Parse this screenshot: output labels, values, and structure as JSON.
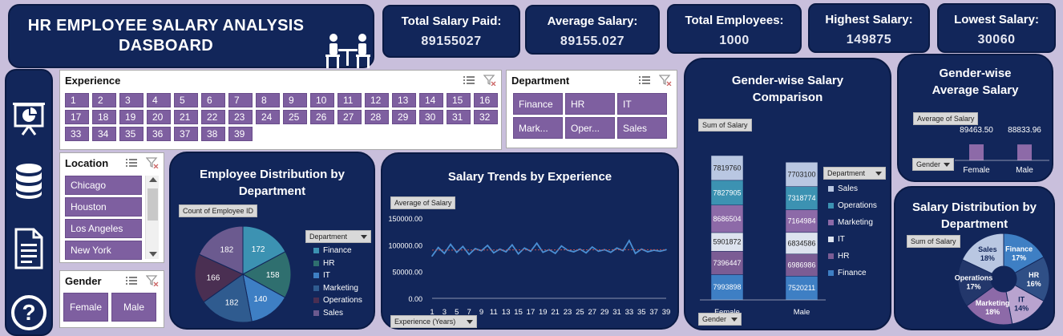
{
  "header": {
    "title_line1": "HR EMPLOYEE SALARY ANALYSIS",
    "title_line2": "DASBOARD"
  },
  "kpis": [
    {
      "label": "Total Salary Paid:",
      "value": "89155027"
    },
    {
      "label": "Average Salary:",
      "value": "89155.027"
    },
    {
      "label": "Total Employees:",
      "value": "1000"
    },
    {
      "label": "Highest Salary:",
      "value": "149875"
    },
    {
      "label": "Lowest Salary:",
      "value": "30060"
    }
  ],
  "sidebar": {
    "icons": [
      "presentation-icon",
      "database-icon",
      "document-icon",
      "help-icon"
    ],
    "help_glyph": "?"
  },
  "slicers": {
    "experience": {
      "title": "Experience",
      "items": [
        "1",
        "2",
        "3",
        "4",
        "5",
        "6",
        "7",
        "8",
        "9",
        "10",
        "11",
        "12",
        "13",
        "14",
        "15",
        "16",
        "17",
        "18",
        "19",
        "20",
        "21",
        "22",
        "23",
        "24",
        "25",
        "26",
        "27",
        "28",
        "29",
        "30",
        "31",
        "32",
        "33",
        "34",
        "35",
        "36",
        "37",
        "38",
        "39"
      ]
    },
    "department": {
      "title": "Department",
      "items": [
        "Finance",
        "HR",
        "IT",
        "Mark...",
        "Oper...",
        "Sales"
      ]
    },
    "location": {
      "title": "Location",
      "items": [
        "Chicago",
        "Houston",
        "Los Angeles",
        "New York"
      ]
    },
    "gender": {
      "title": "Gender",
      "items": [
        "Female",
        "Male"
      ]
    }
  },
  "colors": {
    "panel": "#12265a",
    "slicer_button": "#7e5fa0",
    "background": "#c9bfdc",
    "finance": "#3e7fc4",
    "hr": "#7b5c94",
    "it": "#dde3ef",
    "marketing": "#8d6aa8",
    "operations": "#3c92b2",
    "sales": "#b9c7e2",
    "trend_line": "#4a8fd4",
    "trend_avg": "#c0504d"
  },
  "charts": {
    "dept_pie": {
      "title": "Employee Distribution by Department",
      "field_label": "Count of Employee ID",
      "legend_button": "Department"
    },
    "trend": {
      "title": "Salary Trends by Experience",
      "field_label": "Average of Salary",
      "axis_button": "Experience (Years)"
    },
    "gender_compare": {
      "title": "Gender-wise Salary Comparison",
      "field_label": "Sum of Salary",
      "legend_button": "Department",
      "axis_button": "Gender"
    },
    "gender_avg": {
      "title": "Gender-wise Average Salary",
      "field_label": "Average of Salary",
      "axis_button": "Gender"
    },
    "dept_dist": {
      "title": "Salary Distribution by Department",
      "field_label": "Sum of Salary"
    }
  },
  "chart_data": [
    {
      "type": "pie",
      "categories": [
        "Finance",
        "HR",
        "IT",
        "Marketing",
        "Operations",
        "Sales"
      ],
      "values": [
        172,
        158,
        140,
        182,
        166,
        182
      ],
      "labels_shown": [
        "172",
        "158",
        "140",
        "182",
        "166",
        "182"
      ],
      "legend": [
        "Finance",
        "HR",
        "IT",
        "Marketing",
        "Operations",
        "Sales"
      ]
    },
    {
      "type": "line",
      "title": "Salary Trends by Experience",
      "x": [
        1,
        2,
        3,
        4,
        5,
        6,
        7,
        8,
        9,
        10,
        11,
        12,
        13,
        14,
        15,
        16,
        17,
        18,
        19,
        20,
        21,
        22,
        23,
        24,
        25,
        26,
        27,
        28,
        29,
        30,
        31,
        32,
        33,
        34,
        35,
        36,
        37,
        38,
        39
      ],
      "x_tick_labels": [
        "1",
        "3",
        "5",
        "7",
        "9",
        "11",
        "13",
        "15",
        "17",
        "19",
        "21",
        "23",
        "25",
        "27",
        "29",
        "31",
        "33",
        "35",
        "37",
        "39"
      ],
      "series": [
        {
          "values": [
            79000,
            95000,
            84000,
            101000,
            86000,
            97000,
            82000,
            93000,
            89000,
            99000,
            85000,
            92000,
            87000,
            100000,
            83000,
            94000,
            88000,
            103000,
            86000,
            91000,
            84000,
            98000,
            90000,
            87000,
            92000,
            85000,
            96000,
            88000,
            91000,
            86000,
            94000,
            89000,
            108000,
            84000,
            92000,
            87000,
            90000,
            88000,
            91000
          ]
        }
      ],
      "y_ticks": [
        "0.00",
        "50000.00",
        "100000.00",
        "150000.00"
      ],
      "ylim": [
        0,
        150000
      ],
      "trendline": true
    },
    {
      "type": "bar",
      "categories": [
        "Female",
        "Male"
      ],
      "series": [
        {
          "name": "Finance",
          "values": [
            7993898,
            7520211
          ]
        },
        {
          "name": "HR",
          "values": [
            7396447,
            6986986
          ]
        },
        {
          "name": "IT",
          "values": [
            5901872,
            6834586
          ]
        },
        {
          "name": "Marketing",
          "values": [
            8686504,
            7164984
          ]
        },
        {
          "name": "Operations",
          "values": [
            7827905,
            7318774
          ]
        },
        {
          "name": "Sales",
          "values": [
            7819760,
            7703100
          ]
        }
      ],
      "stacked": true
    },
    {
      "type": "bar",
      "categories": [
        "Female",
        "Male"
      ],
      "values": [
        89463.5,
        88833.96
      ],
      "value_labels": [
        "89463.50",
        "88833.96"
      ]
    },
    {
      "type": "pie",
      "donut": true,
      "categories": [
        "Finance",
        "HR",
        "IT",
        "Marketing",
        "Operations",
        "Sales"
      ],
      "values": [
        17,
        16,
        14,
        18,
        17,
        18
      ],
      "value_labels": [
        "17%",
        "16%",
        "14%",
        "18%",
        "17%",
        "18%"
      ]
    }
  ]
}
